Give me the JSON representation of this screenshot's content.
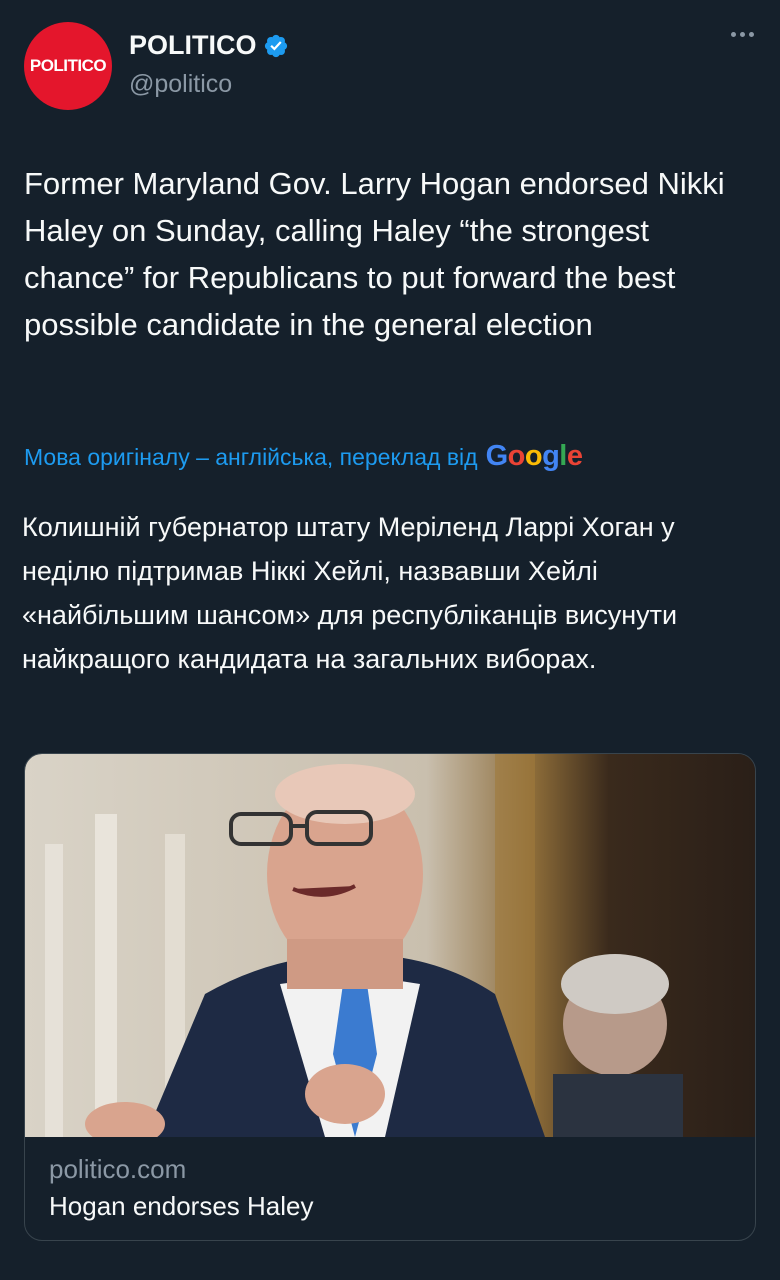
{
  "author": {
    "avatar_text": "POLITICO",
    "name": "POLITICO",
    "handle": "@politico",
    "verified_icon": "verified-badge-icon",
    "more_icon": "more-options-icon"
  },
  "tweet": {
    "text": "Former Maryland Gov. Larry Hogan endorsed Nikki Haley on Sunday, calling Haley “the strongest chance” for Republicans to put forward the best possible candidate in the general election"
  },
  "translation": {
    "label": "Мова оригіналу – англійська, переклад від",
    "provider": "Google",
    "text": "Колишній губернатор штату Меріленд Ларрі Хоган у неділю підтримав Ніккі Хейлі, назвавши Хейлі «найбільшим шансом» для республіканців висунути найкращого кандидата на загальних виборах."
  },
  "card": {
    "domain": "politico.com",
    "title": "Hogan endorses Haley"
  },
  "colors": {
    "background": "#15202b",
    "accent": "#1d9bf0",
    "politico_red": "#e4162c",
    "muted": "#8b98a5"
  }
}
